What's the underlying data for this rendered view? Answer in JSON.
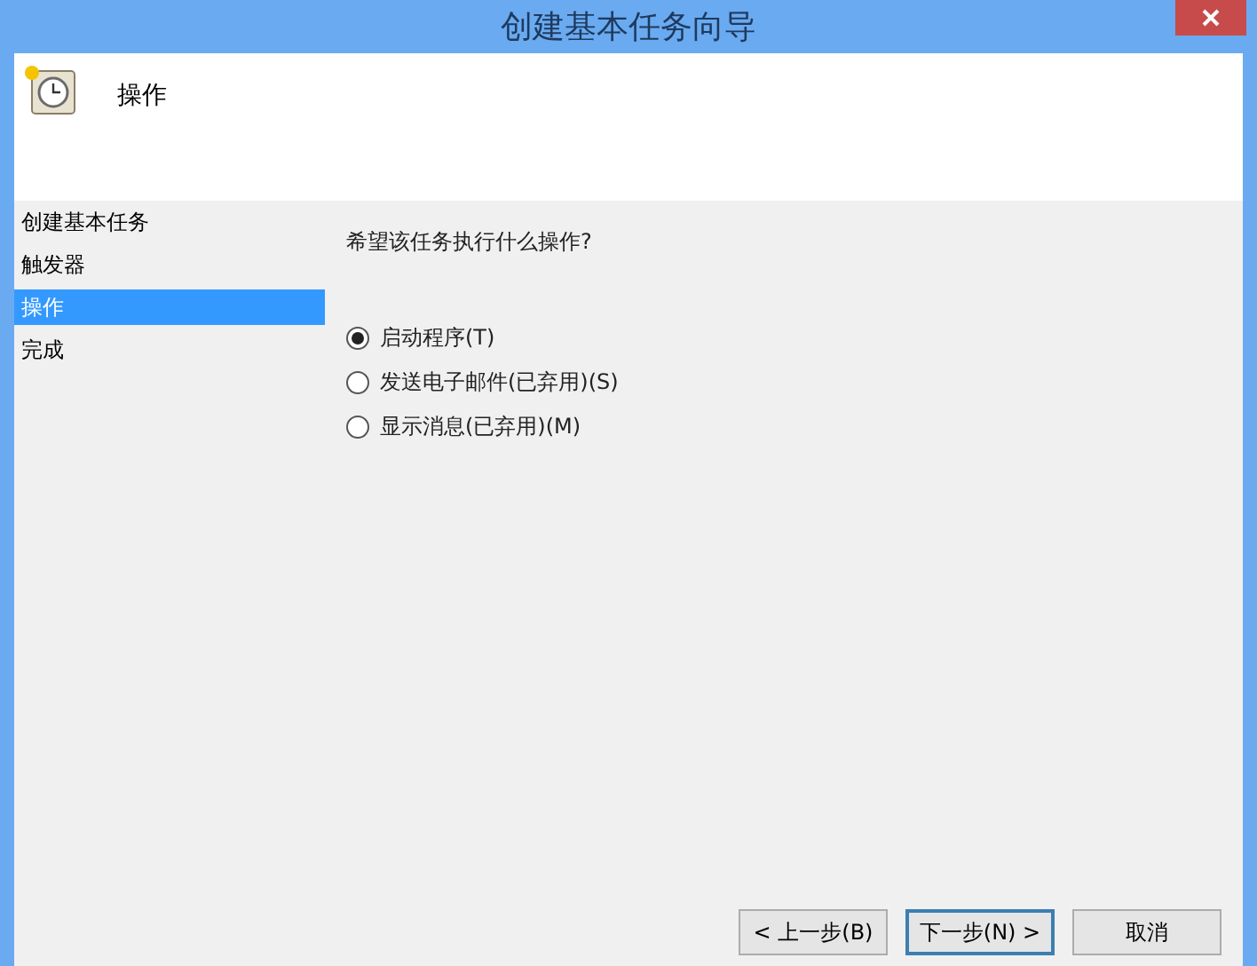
{
  "window": {
    "title": "创建基本任务向导"
  },
  "header": {
    "title": "操作"
  },
  "steps": [
    {
      "label": "创建基本任务",
      "selected": false
    },
    {
      "label": "触发器",
      "selected": false
    },
    {
      "label": "操作",
      "selected": true
    },
    {
      "label": "完成",
      "selected": false
    }
  ],
  "question": "希望该任务执行什么操作?",
  "options": [
    {
      "label": "启动程序(T)",
      "selected": true
    },
    {
      "label": "发送电子邮件(已弃用)(S)",
      "selected": false
    },
    {
      "label": "显示消息(已弃用)(M)",
      "selected": false
    }
  ],
  "buttons": [
    {
      "label": "< 上一步(B)",
      "default": false
    },
    {
      "label": "下一步(N) >",
      "default": true
    },
    {
      "label": "取消",
      "default": false
    }
  ]
}
